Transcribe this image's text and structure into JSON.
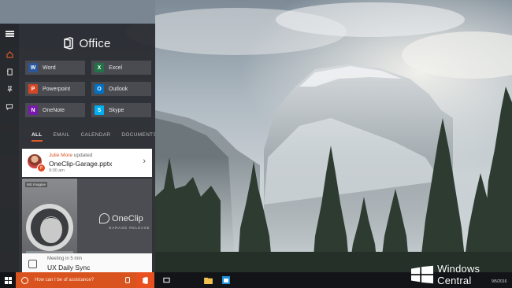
{
  "panel": {
    "title": "Office",
    "apps": [
      {
        "label": "Word",
        "icon": "word-icon",
        "color": "#2b579a",
        "glyph": "W"
      },
      {
        "label": "Excel",
        "icon": "excel-icon",
        "color": "#217346",
        "glyph": "X"
      },
      {
        "label": "Powerpoint",
        "icon": "powerpoint-icon",
        "color": "#d24726",
        "glyph": "P"
      },
      {
        "label": "Outlook",
        "icon": "outlook-icon",
        "color": "#0072c6",
        "glyph": "O"
      },
      {
        "label": "OneNote",
        "icon": "onenote-icon",
        "color": "#7719aa",
        "glyph": "N"
      },
      {
        "label": "Skype",
        "icon": "skype-icon",
        "color": "#00aff0",
        "glyph": "S"
      }
    ],
    "tabs": [
      "ALL",
      "EMAIL",
      "CALENDAR",
      "DOCUMENTS"
    ],
    "active_tab": "ALL"
  },
  "activity": {
    "author": "Julie More",
    "action": "updated",
    "file": "OneClip-Garage.pptx",
    "time": "9:00 am"
  },
  "promo": {
    "tag": "MS Imagine",
    "brand": "OneClip",
    "subtitle": "GARAGE RELEASE"
  },
  "meeting": {
    "pre": "Meeting in 5 min",
    "title": "UX Daily Sync"
  },
  "taskbar": {
    "search_placeholder": "How can I be of assistance?"
  },
  "watermark": {
    "brand": "Windows Central",
    "date": "9/5/2016"
  },
  "colors": {
    "accent": "#d9531e",
    "panel_bg": "#26282d"
  }
}
